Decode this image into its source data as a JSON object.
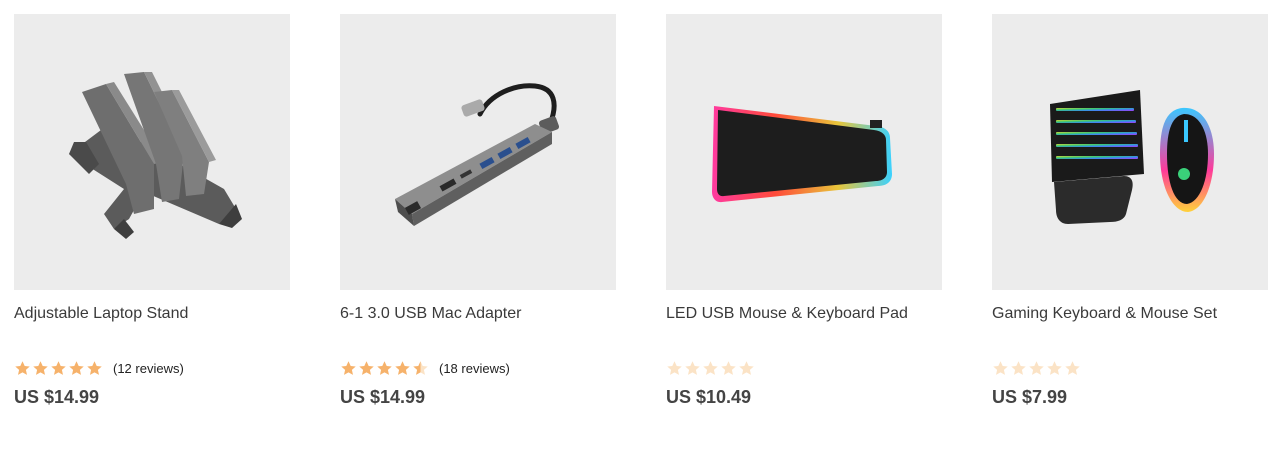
{
  "colors": {
    "star_filled": "#f6b26b",
    "star_empty": "#fbe3c6",
    "thumb_bg": "#ececec"
  },
  "products": [
    {
      "title": "Adjustable Laptop Stand",
      "image_icon": "laptop-stand-image",
      "rating": 5,
      "reviews": "(12 reviews)",
      "price": "US $14.99"
    },
    {
      "title": "6-1 3.0 USB Mac Adapter",
      "image_icon": "usb-adapter-image",
      "rating": 4.5,
      "reviews": "(18 reviews)",
      "price": "US $14.99"
    },
    {
      "title": "LED USB Mouse & Keyboard Pad",
      "image_icon": "led-mouse-pad-image",
      "rating": 0,
      "reviews": "",
      "price": "US $10.49"
    },
    {
      "title": "Gaming Keyboard & Mouse Set",
      "image_icon": "gaming-keyboard-mouse-image",
      "rating": 0,
      "reviews": "",
      "price": "US $7.99"
    }
  ]
}
